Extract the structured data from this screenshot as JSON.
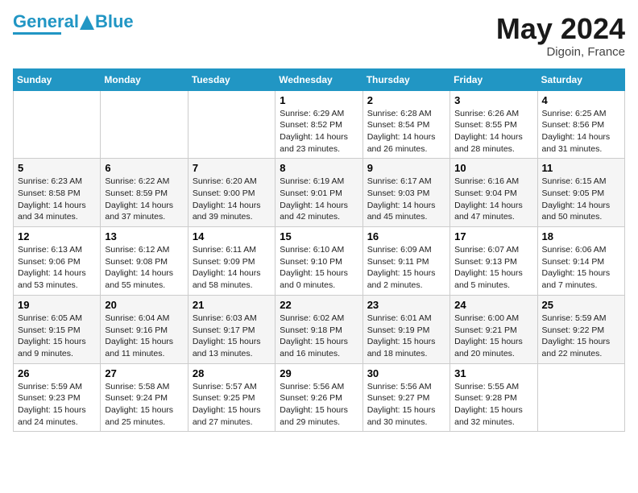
{
  "header": {
    "logo_general": "General",
    "logo_blue": "Blue",
    "month": "May 2024",
    "location": "Digoin, France"
  },
  "days_of_week": [
    "Sunday",
    "Monday",
    "Tuesday",
    "Wednesday",
    "Thursday",
    "Friday",
    "Saturday"
  ],
  "weeks": [
    [
      {
        "day": "",
        "content": ""
      },
      {
        "day": "",
        "content": ""
      },
      {
        "day": "",
        "content": ""
      },
      {
        "day": "1",
        "content": "Sunrise: 6:29 AM\nSunset: 8:52 PM\nDaylight: 14 hours\nand 23 minutes."
      },
      {
        "day": "2",
        "content": "Sunrise: 6:28 AM\nSunset: 8:54 PM\nDaylight: 14 hours\nand 26 minutes."
      },
      {
        "day": "3",
        "content": "Sunrise: 6:26 AM\nSunset: 8:55 PM\nDaylight: 14 hours\nand 28 minutes."
      },
      {
        "day": "4",
        "content": "Sunrise: 6:25 AM\nSunset: 8:56 PM\nDaylight: 14 hours\nand 31 minutes."
      }
    ],
    [
      {
        "day": "5",
        "content": "Sunrise: 6:23 AM\nSunset: 8:58 PM\nDaylight: 14 hours\nand 34 minutes."
      },
      {
        "day": "6",
        "content": "Sunrise: 6:22 AM\nSunset: 8:59 PM\nDaylight: 14 hours\nand 37 minutes."
      },
      {
        "day": "7",
        "content": "Sunrise: 6:20 AM\nSunset: 9:00 PM\nDaylight: 14 hours\nand 39 minutes."
      },
      {
        "day": "8",
        "content": "Sunrise: 6:19 AM\nSunset: 9:01 PM\nDaylight: 14 hours\nand 42 minutes."
      },
      {
        "day": "9",
        "content": "Sunrise: 6:17 AM\nSunset: 9:03 PM\nDaylight: 14 hours\nand 45 minutes."
      },
      {
        "day": "10",
        "content": "Sunrise: 6:16 AM\nSunset: 9:04 PM\nDaylight: 14 hours\nand 47 minutes."
      },
      {
        "day": "11",
        "content": "Sunrise: 6:15 AM\nSunset: 9:05 PM\nDaylight: 14 hours\nand 50 minutes."
      }
    ],
    [
      {
        "day": "12",
        "content": "Sunrise: 6:13 AM\nSunset: 9:06 PM\nDaylight: 14 hours\nand 53 minutes."
      },
      {
        "day": "13",
        "content": "Sunrise: 6:12 AM\nSunset: 9:08 PM\nDaylight: 14 hours\nand 55 minutes."
      },
      {
        "day": "14",
        "content": "Sunrise: 6:11 AM\nSunset: 9:09 PM\nDaylight: 14 hours\nand 58 minutes."
      },
      {
        "day": "15",
        "content": "Sunrise: 6:10 AM\nSunset: 9:10 PM\nDaylight: 15 hours\nand 0 minutes."
      },
      {
        "day": "16",
        "content": "Sunrise: 6:09 AM\nSunset: 9:11 PM\nDaylight: 15 hours\nand 2 minutes."
      },
      {
        "day": "17",
        "content": "Sunrise: 6:07 AM\nSunset: 9:13 PM\nDaylight: 15 hours\nand 5 minutes."
      },
      {
        "day": "18",
        "content": "Sunrise: 6:06 AM\nSunset: 9:14 PM\nDaylight: 15 hours\nand 7 minutes."
      }
    ],
    [
      {
        "day": "19",
        "content": "Sunrise: 6:05 AM\nSunset: 9:15 PM\nDaylight: 15 hours\nand 9 minutes."
      },
      {
        "day": "20",
        "content": "Sunrise: 6:04 AM\nSunset: 9:16 PM\nDaylight: 15 hours\nand 11 minutes."
      },
      {
        "day": "21",
        "content": "Sunrise: 6:03 AM\nSunset: 9:17 PM\nDaylight: 15 hours\nand 13 minutes."
      },
      {
        "day": "22",
        "content": "Sunrise: 6:02 AM\nSunset: 9:18 PM\nDaylight: 15 hours\nand 16 minutes."
      },
      {
        "day": "23",
        "content": "Sunrise: 6:01 AM\nSunset: 9:19 PM\nDaylight: 15 hours\nand 18 minutes."
      },
      {
        "day": "24",
        "content": "Sunrise: 6:00 AM\nSunset: 9:21 PM\nDaylight: 15 hours\nand 20 minutes."
      },
      {
        "day": "25",
        "content": "Sunrise: 5:59 AM\nSunset: 9:22 PM\nDaylight: 15 hours\nand 22 minutes."
      }
    ],
    [
      {
        "day": "26",
        "content": "Sunrise: 5:59 AM\nSunset: 9:23 PM\nDaylight: 15 hours\nand 24 minutes."
      },
      {
        "day": "27",
        "content": "Sunrise: 5:58 AM\nSunset: 9:24 PM\nDaylight: 15 hours\nand 25 minutes."
      },
      {
        "day": "28",
        "content": "Sunrise: 5:57 AM\nSunset: 9:25 PM\nDaylight: 15 hours\nand 27 minutes."
      },
      {
        "day": "29",
        "content": "Sunrise: 5:56 AM\nSunset: 9:26 PM\nDaylight: 15 hours\nand 29 minutes."
      },
      {
        "day": "30",
        "content": "Sunrise: 5:56 AM\nSunset: 9:27 PM\nDaylight: 15 hours\nand 30 minutes."
      },
      {
        "day": "31",
        "content": "Sunrise: 5:55 AM\nSunset: 9:28 PM\nDaylight: 15 hours\nand 32 minutes."
      },
      {
        "day": "",
        "content": ""
      }
    ]
  ]
}
